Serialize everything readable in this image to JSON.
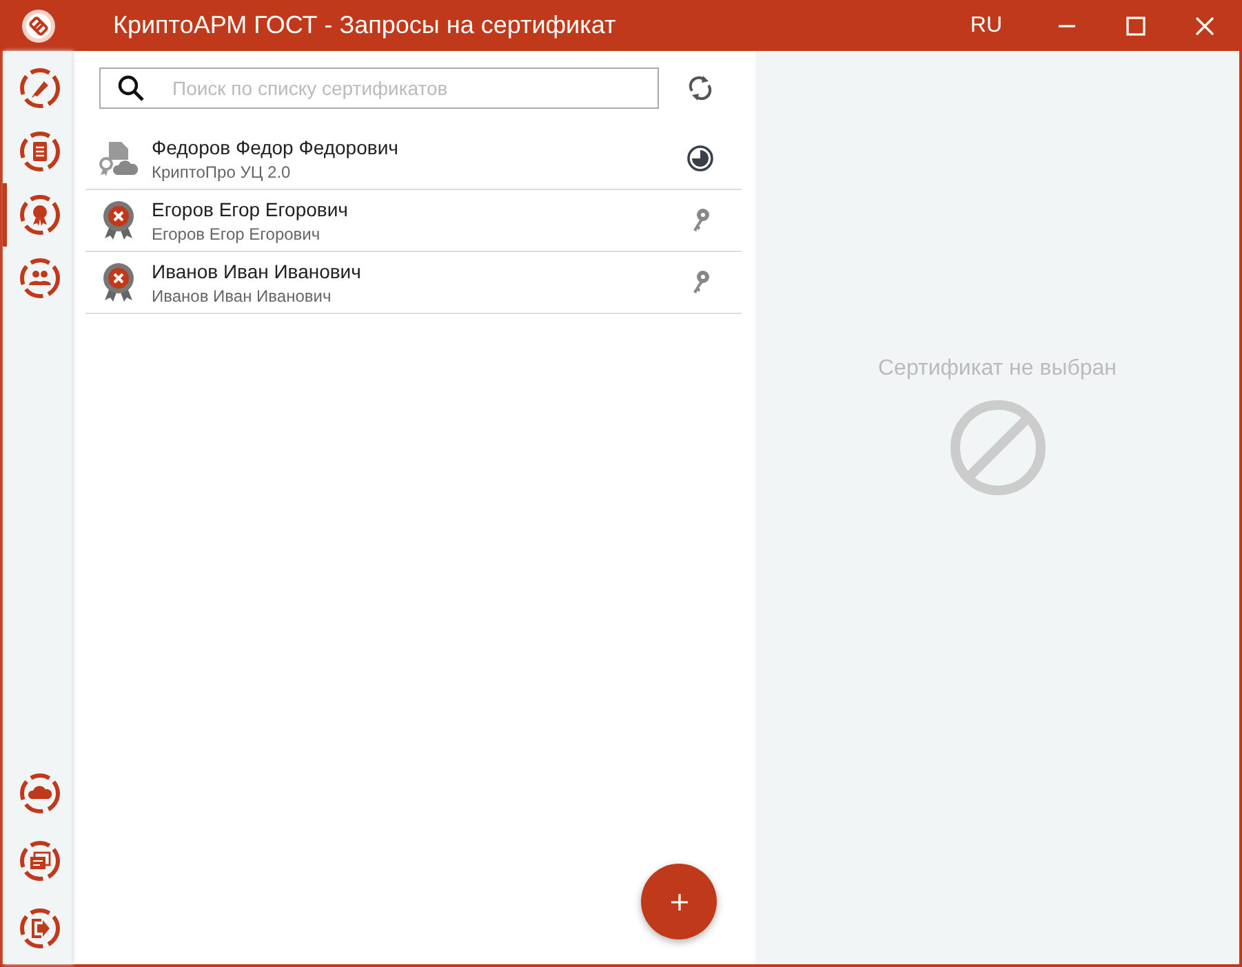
{
  "window": {
    "title": "КриптоАРМ ГОСТ - Запросы на сертификат",
    "language": "RU"
  },
  "sidebar": {
    "top_items": [
      {
        "kind": "sign",
        "selected": false
      },
      {
        "kind": "documents",
        "selected": false
      },
      {
        "kind": "certificates",
        "selected": true
      },
      {
        "kind": "contacts",
        "selected": false
      }
    ],
    "bottom_items": [
      {
        "kind": "cloud",
        "selected": false
      },
      {
        "kind": "services",
        "selected": false
      },
      {
        "kind": "exit",
        "selected": false
      }
    ]
  },
  "search": {
    "placeholder": "Поиск по списку сертификатов"
  },
  "requests": [
    {
      "name": "Федоров Федор Федорович",
      "subtitle": "КриптоПро УЦ 2.0",
      "kind": "pending"
    },
    {
      "name": "Егоров Егор Егорович",
      "subtitle": "Егоров Егор Егорович",
      "kind": "invalid"
    },
    {
      "name": "Иванов Иван Иванович",
      "subtitle": "Иванов Иван Иванович",
      "kind": "invalid"
    }
  ],
  "detail": {
    "empty_message": "Сертификат не выбран"
  }
}
